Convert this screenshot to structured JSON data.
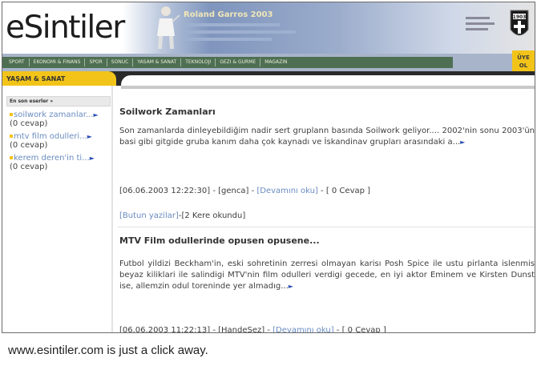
{
  "header": {
    "logo_text": "eSintiler",
    "ad_title": "Roland Garros 2003"
  },
  "nav": {
    "items": [
      "SPORT",
      "EKONOMI & FINANS",
      "SPOR",
      "SONUC",
      "YASAM & SANAT",
      "TEKNOLOJI",
      "GEZI & GURME",
      "MAGAZIN"
    ],
    "badge": "ÜYE OL"
  },
  "section": {
    "title": "YAŞAM & SANAT"
  },
  "sidebar": {
    "heading": "En son eserler »",
    "items": [
      {
        "link": "soilwork zamanlar...",
        "count": "(0 cevap)"
      },
      {
        "link": "mtv film odulleri...",
        "count": "(0 cevap)"
      },
      {
        "link": "kerem deren'in ti...",
        "count": "(0 cevap)"
      }
    ]
  },
  "entries": [
    {
      "title": "Soilwork Zamanları",
      "body": "Son zamanlarda dinleyebildiğim nadir sert gruplann basında Soilwork geliyor.... 2002'nin sonu 2003'ün basi gibi gitgide gruba kanım daha çok kaynadı ve İskandinav grupları arasındaki a...",
      "date": "[06.06.2003 12:22:30]",
      "author": "[genca]",
      "more": "[Devamını oku]",
      "replies": "[ 0 Cevap ]",
      "all_posts": "[Butun yazilar]",
      "read_count": "-[2 Kere okundu]"
    },
    {
      "title": "MTV Film odullerinde opusen opusene...",
      "body": "Futbol yildizi Beckham'in, eski sohretinin zerresi olmayan karisı Posh Spice ile ustu pirlanta islenmis beyaz kiliklari ile salindigi MTV'nin film odulleri verdigi gecede, en iyi aktor Eminem ve Kirsten Dunst ise, allemzin odul toreninde yer almadıg...",
      "date": "[06.06.2003 11:22:13]",
      "author": "[HandeSez]",
      "more": "[Devamını oku]",
      "replies": "[ 0 Cevap ]"
    }
  ],
  "caption": "www.esintiler.com is just a click away."
}
